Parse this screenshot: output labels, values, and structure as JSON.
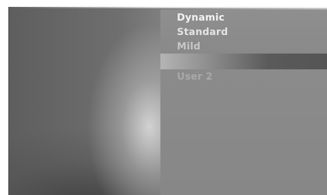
{
  "picture_menu": {
    "items": [
      {
        "label": "Dynamic"
      },
      {
        "label": "Standard"
      },
      {
        "label": "Mild"
      },
      {
        "label": ""
      },
      {
        "label": "User 2"
      }
    ],
    "highlighted_index": 3
  },
  "colors": {
    "panel": "#8a8a8a",
    "highlight_dark": "#555555",
    "highlight_light": "#b4b4b4",
    "text_active": "#f2f2f2",
    "text_dim": "#a9a9a9"
  }
}
